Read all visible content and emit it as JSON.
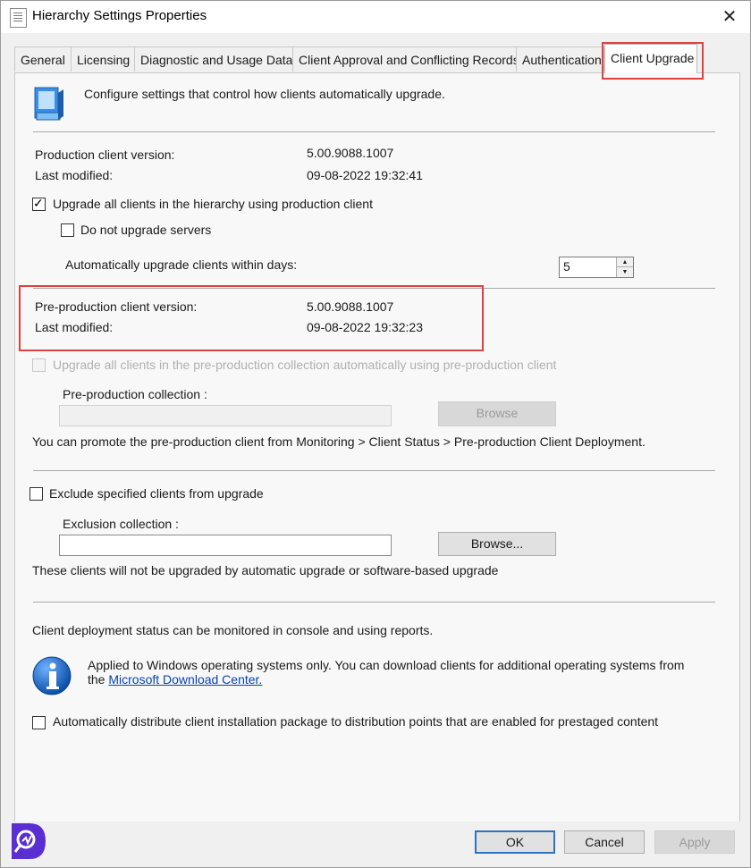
{
  "window": {
    "title": "Hierarchy Settings Properties",
    "close_glyph": "✕"
  },
  "tabs": [
    {
      "label": "General"
    },
    {
      "label": "Licensing"
    },
    {
      "label": "Diagnostic and Usage Data"
    },
    {
      "label": "Client Approval and Conflicting Records"
    },
    {
      "label": "Authentication"
    },
    {
      "label": "Client Upgrade",
      "active": true
    }
  ],
  "header_text": "Configure settings that control how clients automatically upgrade.",
  "production": {
    "version_label": "Production client version:",
    "version_value": "5.00.9088.1007",
    "modified_label": "Last modified:",
    "modified_value": "09-08-2022 19:32:41"
  },
  "upgrade_all": {
    "label": "Upgrade all clients in the hierarchy using production client",
    "checked": true
  },
  "no_upgrade_servers": {
    "label": "Do not upgrade servers",
    "checked": false
  },
  "auto_days": {
    "label": "Automatically upgrade clients within days:",
    "value": "5"
  },
  "preproduction": {
    "version_label": "Pre-production client version:",
    "version_value": "5.00.9088.1007",
    "modified_label": "Last modified:",
    "modified_value": "09-08-2022 19:32:23"
  },
  "preprod_upgrade": {
    "label": "Upgrade all clients in the pre-production collection automatically using pre-production client",
    "checked": false,
    "disabled": true
  },
  "preprod_collection": {
    "label": "Pre-production collection :",
    "value": "",
    "browse_label": "Browse"
  },
  "promote_note": "You can promote the pre-production client from Monitoring > Client Status > Pre-production Client Deployment.",
  "exclude": {
    "label": "Exclude specified clients from upgrade",
    "checked": false
  },
  "exclusion_collection": {
    "label": "Exclusion collection :",
    "value": "",
    "browse_label": "Browse..."
  },
  "exclude_note": "These clients will not be upgraded by automatic upgrade or software-based upgrade",
  "deploy_status_note": "Client deployment status can be monitored in console and using reports.",
  "info_text_1": "Applied to Windows operating systems only. You can download clients for additional operating systems from",
  "info_text_2": "the",
  "info_link": "Microsoft Download Center.",
  "auto_distribute": {
    "label": "Automatically distribute client installation package to distribution points that are enabled for prestaged content",
    "checked": false
  },
  "buttons": {
    "ok": "OK",
    "cancel": "Cancel",
    "apply": "Apply"
  },
  "colors": {
    "highlight": "#e04040",
    "link": "#0645ad",
    "default_button_border": "#2a73c8"
  }
}
